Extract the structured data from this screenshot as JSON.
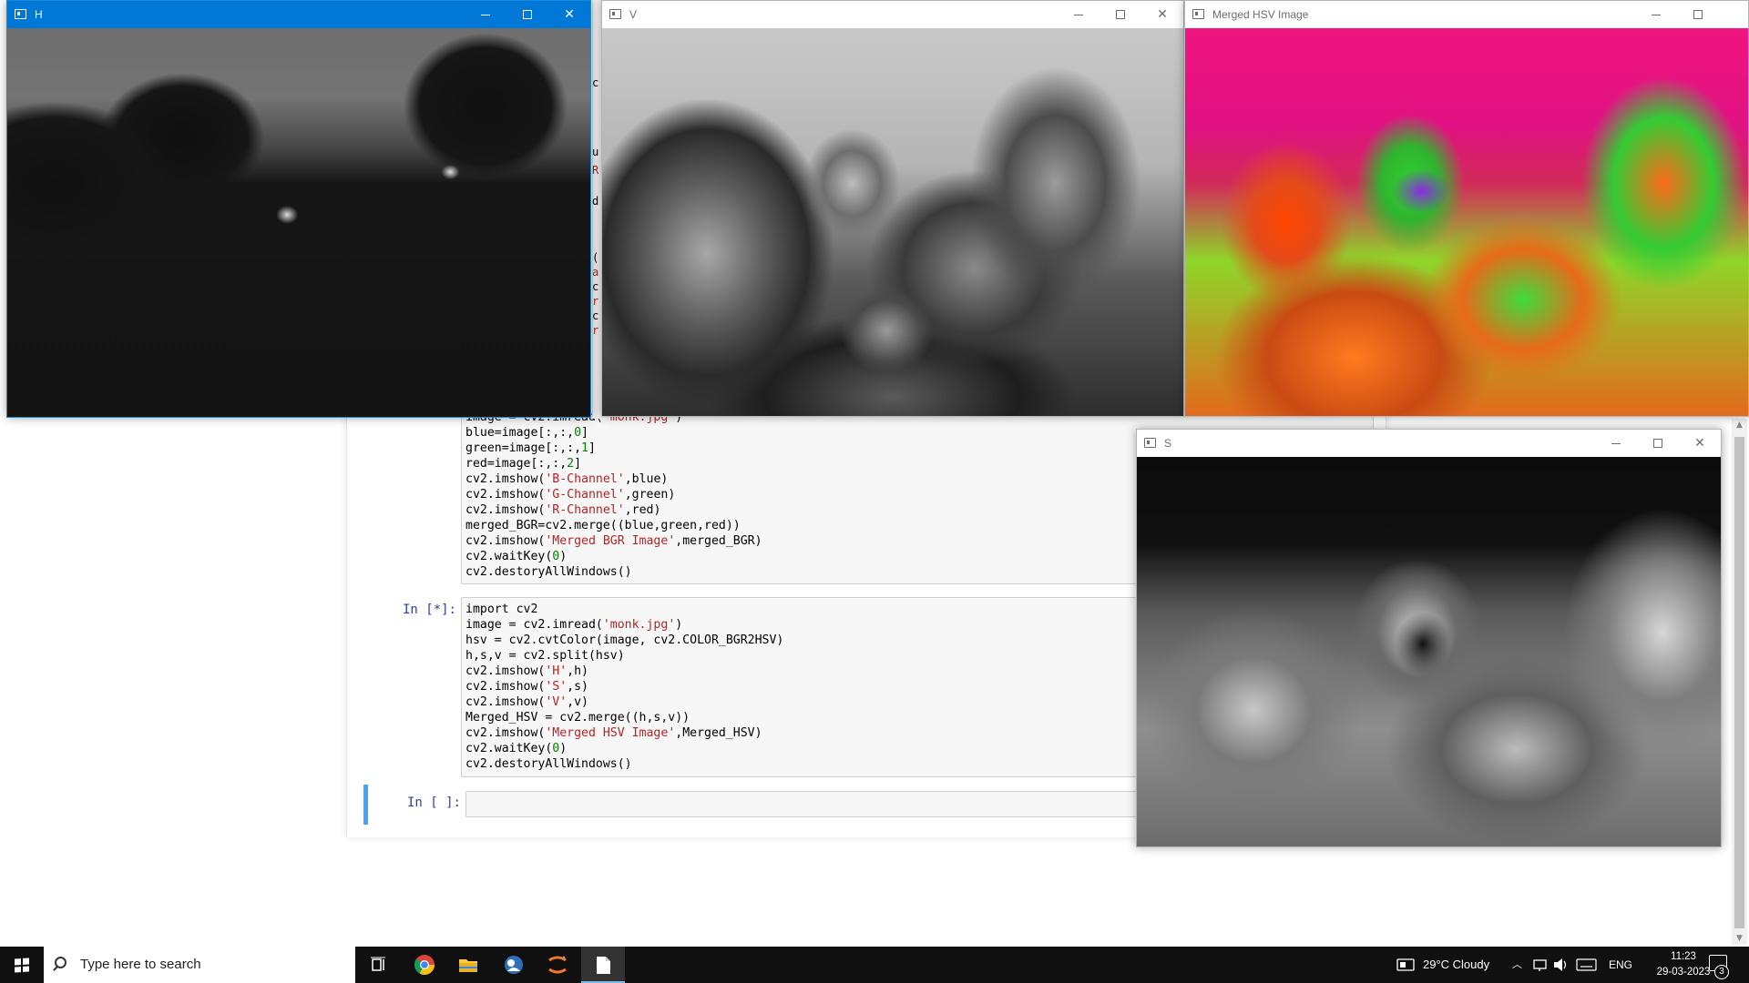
{
  "notebook": {
    "cell1": {
      "lines": [
        "image = cv2.imread('monk.jpg')",
        "blue=image[:,:,0]",
        "green=image[:,:,1]",
        "red=image[:,:,2]",
        "cv2.imshow('B-Channel',blue)",
        "cv2.imshow('G-Channel',green)",
        "cv2.imshow('R-Channel',red)",
        "merged_BGR=cv2.merge((blue,green,red))",
        "cv2.imshow('Merged BGR Image',merged_BGR)",
        "cv2.waitKey(0)",
        "cv2.destoryAllWindows()"
      ]
    },
    "cell2": {
      "prompt": "In [*]:",
      "lines": [
        "import cv2",
        "image = cv2.imread('monk.jpg')",
        "hsv = cv2.cvtColor(image, cv2.COLOR_BGR2HSV)",
        "h,s,v = cv2.split(hsv)",
        "cv2.imshow('H',h)",
        "cv2.imshow('S',s)",
        "cv2.imshow('V',v)",
        "Merged_HSV = cv2.merge((h,s,v))",
        "cv2.imshow('Merged HSV Image',Merged_HSV)",
        "cv2.waitKey(0)",
        "cv2.destoryAllWindows()"
      ]
    },
    "cell3": {
      "prompt": "In [ ]:"
    }
  },
  "windows": {
    "h": {
      "title": "H",
      "state": "focused"
    },
    "v": {
      "title": "V"
    },
    "merged": {
      "title": "Merged HSV Image"
    },
    "s": {
      "title": "S"
    }
  },
  "taskbar": {
    "search_placeholder": "Type here to search",
    "weather": "29°C  Cloudy",
    "language": "ENG",
    "time": "11:23",
    "date": "29-03-2023",
    "notification_count": "3",
    "apps": [
      "task-view",
      "chrome",
      "file-explorer",
      "app",
      "jupyter",
      "notepad"
    ]
  },
  "colors": {
    "accent": "#0078d7",
    "jupyter_prompt": "#303f9f",
    "string": "#ba2121",
    "number": "#008000",
    "active_cell": "#42a5f5"
  }
}
